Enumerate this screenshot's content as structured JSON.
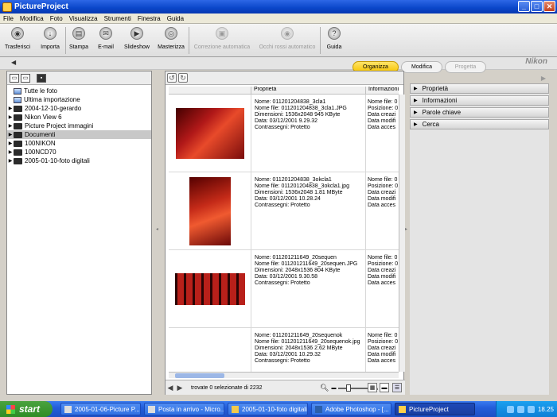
{
  "window": {
    "title": "PictureProject"
  },
  "menu": [
    "File",
    "Modifica",
    "Foto",
    "Visualizza",
    "Strumenti",
    "Finestra",
    "Guida"
  ],
  "toolbar": [
    {
      "label": "Trasferisci",
      "icon": "camera-icon",
      "enabled": true
    },
    {
      "label": "Importa",
      "icon": "import-icon",
      "enabled": true
    },
    {
      "label": "Stampa",
      "icon": "printer-icon",
      "enabled": true
    },
    {
      "label": "E-mail",
      "icon": "email-icon",
      "enabled": true
    },
    {
      "label": "Slideshow",
      "icon": "slideshow-icon",
      "enabled": true
    },
    {
      "label": "Masterizza",
      "icon": "burn-disc-icon",
      "enabled": true
    },
    {
      "label": "Correzione automatica",
      "icon": "auto-correct-icon",
      "enabled": false
    },
    {
      "label": "Occhi rossi automatico",
      "icon": "red-eye-icon",
      "enabled": false
    },
    {
      "label": "Guida",
      "icon": "help-icon",
      "enabled": true
    }
  ],
  "mode_tabs": [
    "Organizza",
    "Modifica",
    "Progetta"
  ],
  "logo": "Nikon",
  "tree": {
    "top": [
      {
        "label": "Tutte le foto"
      },
      {
        "label": "Ultima importazione"
      }
    ],
    "folders": [
      {
        "label": "2004-12-10-gerardo",
        "selected": false
      },
      {
        "label": "Nikon View 6",
        "selected": false
      },
      {
        "label": "Picture Project immagini",
        "selected": false
      },
      {
        "label": "Documenti",
        "selected": true
      },
      {
        "label": "100NIKON",
        "selected": false
      },
      {
        "label": "100NCD70",
        "selected": false
      },
      {
        "label": "2005-01-10-foto digitali",
        "selected": false
      }
    ]
  },
  "columns": [
    "Proprietà",
    "Informazioni file"
  ],
  "photos": [
    {
      "lines": [
        "Nome: 011201204838_3cla1",
        "Nome file: 011201204838_3cla1.JPG",
        "Dimensioni: 1536x2048  945 KByte",
        "Data: 03/12/2001 9.29.32",
        "Contrassegni: Protetto"
      ],
      "info": [
        "Nome file: 0",
        "Posizione: 0",
        "Data creazi",
        "Data modifi",
        "Data acces"
      ]
    },
    {
      "lines": [
        "Nome: 011201204838_3okcla1",
        "Nome file: 011201204838_3okcla1.jpg",
        "Dimensioni: 1536x2048  1.81 MByte",
        "Data: 03/12/2001 10.28.24",
        "Contrassegni: Protetto"
      ],
      "info": [
        "Nome file: 0",
        "Posizione: 0",
        "Data creazi",
        "Data modifi",
        "Data acces"
      ]
    },
    {
      "lines": [
        "Nome: 011201211649_20sequen",
        "Nome file: 011201211649_20sequen.JPG",
        "Dimensioni: 2048x1536  804 KByte",
        "Data: 03/12/2001 9.30.58",
        "Contrassegni: Protetto"
      ],
      "info": [
        "Nome file: 0",
        "Posizione: 0",
        "Data creazi",
        "Data modifi",
        "Data acces"
      ]
    },
    {
      "lines": [
        "Nome: 011201211649_20sequenok",
        "Nome file: 011201211649_20sequenok.jpg",
        "Dimensioni: 2048x1536  2.62 MByte",
        "Data: 03/12/2001 10.29.32",
        "Contrassegni: Protetto"
      ],
      "info": [
        "Nome file: 0",
        "Posizione: 0",
        "Data creazi",
        "Data modifi",
        "Data acces"
      ]
    }
  ],
  "status": {
    "count_text": "trovate 0 selezionate di 2232"
  },
  "right_panel": [
    "Proprietà",
    "Informazioni",
    "Parole chiave",
    "Cerca"
  ],
  "taskbar": {
    "start": "start",
    "tasks": [
      {
        "label": "2005-01-06-Picture P...",
        "active": false
      },
      {
        "label": "Posta in arrivo - Micro...",
        "active": false
      },
      {
        "label": "2005-01-10-foto digitali",
        "active": false
      },
      {
        "label": "Adobe Photoshop - [...",
        "active": false
      },
      {
        "label": "PictureProject",
        "active": true
      }
    ],
    "clock": "18.25"
  },
  "colors": {
    "title_bar": "#0a46c9",
    "active_tab": "#f7c400",
    "taskbar": "#245edb",
    "start": "#2f8c25"
  }
}
